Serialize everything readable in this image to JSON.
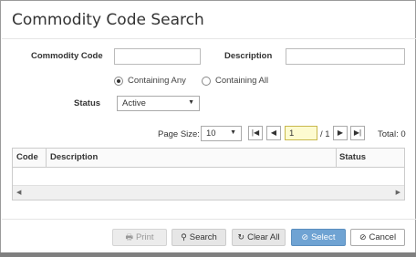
{
  "dialog": {
    "title": "Commodity Code Search"
  },
  "form": {
    "commodity_code_label": "Commodity Code",
    "commodity_code_value": "",
    "description_label": "Description",
    "description_value": "",
    "match_mode": {
      "options": [
        {
          "label": "Containing Any",
          "selected": true
        },
        {
          "label": "Containing All",
          "selected": false
        }
      ]
    },
    "status_label": "Status",
    "status_value": "Active"
  },
  "pager": {
    "page_size_label": "Page Size:",
    "page_size_value": "10",
    "current_page": "1",
    "total_pages": "/ 1",
    "total": "Total: 0"
  },
  "grid": {
    "columns": [
      "Code",
      "Description",
      "Status"
    ],
    "rows": []
  },
  "buttons": {
    "print": "Print",
    "search": "Search",
    "clear_all": "Clear All",
    "select": "Select",
    "cancel": "Cancel"
  },
  "colors": {
    "primary": "#6fa3d3",
    "page_input_bg": "#fdfbd0"
  }
}
